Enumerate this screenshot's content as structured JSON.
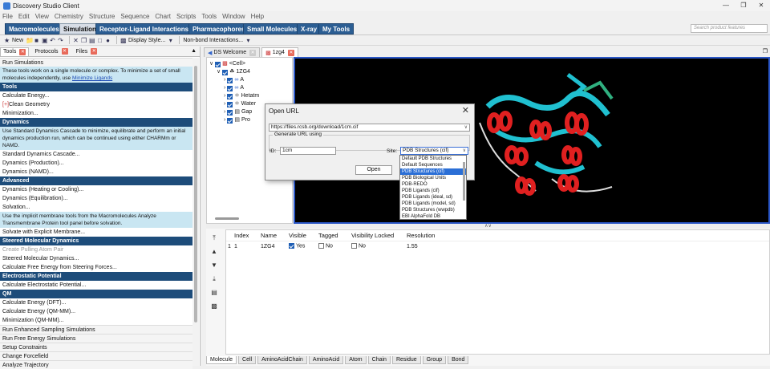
{
  "window": {
    "title": "Discovery Studio Client"
  },
  "menu": [
    "File",
    "Edit",
    "View",
    "Chemistry",
    "Structure",
    "Sequence",
    "Chart",
    "Scripts",
    "Tools",
    "Window",
    "Help"
  ],
  "ribbon": {
    "tabs": [
      "Macromolecules",
      "Simulation",
      "Receptor-Ligand Interactions",
      "Pharmacophores",
      "Small Molecules",
      "X-ray",
      "My Tools"
    ],
    "active": "Simulation",
    "search_placeholder": "Search product features"
  },
  "toolbar": {
    "new_label": "New",
    "display_style_label": "Display Style...",
    "nonbond_label": "Non-bond Interactions..."
  },
  "left_tabs": [
    {
      "label": "Tools"
    },
    {
      "label": "Protocols"
    },
    {
      "label": "Files"
    }
  ],
  "tools_panel": {
    "run_simulations": "Run Simulations",
    "intro": "These tools work on a single molecule or complex. To minimize a set of small molecules independently, use",
    "intro_link": "Minimize Ligands",
    "tools_header": "Tools",
    "calc_energy": "Calculate Energy...",
    "clean_geometry": "Clean Geometry",
    "minimization": "Minimization...",
    "dynamics_header": "Dynamics",
    "dynamics_desc": "Use Standard Dynamics Cascade to minimize, equilibrate and perform an initial dynamics production run, which can be continued using either CHARMm or NAMD.",
    "std_cascade": "Standard Dynamics Cascade...",
    "dyn_production": "Dynamics (Production)...",
    "dyn_namd": "Dynamics (NAMD)...",
    "advanced_header": "Advanced",
    "dyn_heating": "Dynamics (Heating or Cooling)...",
    "dyn_equil": "Dynamics (Equilibration)...",
    "solvation": "Solvation...",
    "membrane_desc": "Use the implicit membrane tools from the Macromolecules Analyze Transmembrane Protein tool panel before solvation.",
    "solvate_membrane": "Solvate with Explicit Membrane...",
    "steered_header": "Steered Molecular Dynamics",
    "pulling_atom": "Create Pulling Atom Pair",
    "steered_md": "Steered Molecular Dynamics...",
    "free_energy_steering": "Calculate Free Energy from Steering Forces...",
    "electrostatic_header": "Electrostatic Potential",
    "calc_electro": "Calculate Electrostatic Potential...",
    "qm_header": "QM",
    "calc_dft": "Calculate Energy (DFT)...",
    "calc_qmmm": "Calculate Energy (QM-MM)...",
    "min_qmmm": "Minimization (QM-MM)...",
    "enhanced": "Run Enhanced Sampling Simulations",
    "free_energy_sims": "Run Free Energy Simulations",
    "constraints": "Setup Constraints",
    "forcefield": "Change Forcefield",
    "trajectory": "Analyze Trajectory"
  },
  "doc_tabs": [
    {
      "label": "DS Welcome"
    },
    {
      "label": "1zg4"
    }
  ],
  "tree": {
    "cell": "<Cell>",
    "mol": "1ZG4",
    "chain_a1": "A",
    "chain_a2": "A",
    "hetatm": "Hetatm",
    "water": "Water",
    "gap": "Gap",
    "prot": "Pro"
  },
  "table": {
    "columns": [
      "Index",
      "Name",
      "Visible",
      "Tagged",
      "Visibility Locked",
      "Resolution"
    ],
    "row": {
      "num": "1",
      "index": "1",
      "name": "1ZG4",
      "visible": "Yes",
      "tagged": "No",
      "locked": "No",
      "resolution": "1.55"
    }
  },
  "bottom_tabs": [
    "Molecule",
    "Cell",
    "AminoAcidChain",
    "AminoAcid",
    "Atom",
    "Chain",
    "Residue",
    "Group",
    "Bond"
  ],
  "dialog": {
    "title": "Open URL",
    "url": "https://files.rcsb.org/download/1cm.cif",
    "group_title": "Generate URL using",
    "id_label": "ID:",
    "id_value": "1cm",
    "site_label": "Site:",
    "site_value": "PDB Structures (cif)",
    "open_button": "Open",
    "site_options": [
      "Default PDB Structures",
      "Default Sequences",
      "PDB Structures (cif)",
      "PDB Biological Units",
      "PDB-REDO",
      "PDB Ligands (cif)",
      "PDB Ligands (ideal, sd)",
      "PDB Ligands (model, sd)",
      "PDB Structures (wwpdb)",
      "EBI AlphaFold DB"
    ],
    "selected_option": 2
  },
  "colors": {
    "accent": "#2c5e93",
    "section_header": "#1d4c7a",
    "desc_bg": "#c9e6f2",
    "viewport_border": "#2a56c6",
    "helix": "#e02020",
    "strand": "#20c0d0"
  }
}
